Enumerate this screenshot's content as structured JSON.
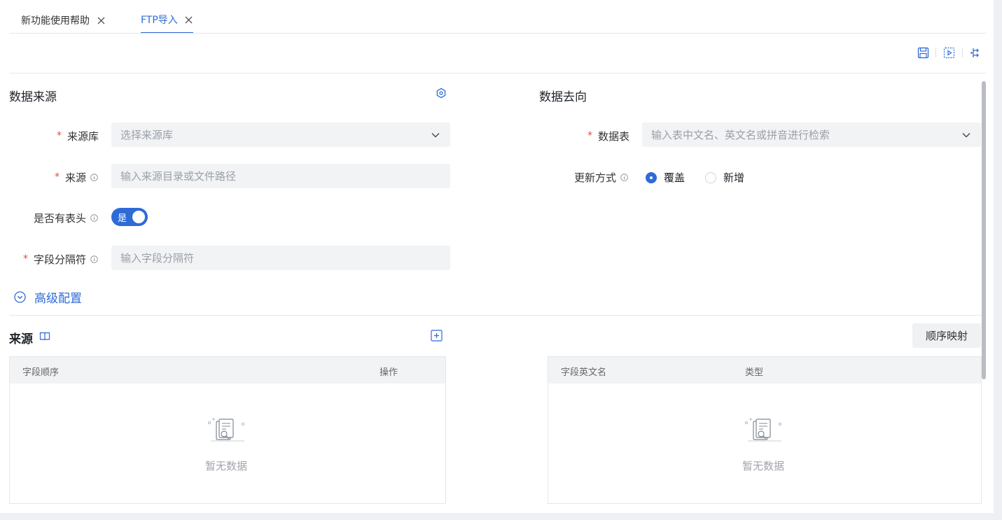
{
  "tabs": [
    {
      "label": "新功能使用帮助",
      "active": false
    },
    {
      "label": "FTP导入",
      "active": true
    }
  ],
  "toolbar": {
    "icons": [
      "save-icon",
      "run-icon",
      "split-icon"
    ]
  },
  "source_panel": {
    "title": "数据来源",
    "settings_icon": "settings-icon",
    "fields": {
      "source_db": {
        "label": "来源库",
        "required": true,
        "placeholder": "选择来源库"
      },
      "source_path": {
        "label": "来源",
        "required": true,
        "placeholder": "输入来源目录或文件路径"
      },
      "has_header": {
        "label": "是否有表头",
        "value": "是",
        "on": true
      },
      "delimiter": {
        "label": "字段分隔符",
        "required": true,
        "placeholder": "输入字段分隔符"
      }
    },
    "advanced_label": "高级配置"
  },
  "target_panel": {
    "title": "数据去向",
    "fields": {
      "table": {
        "label": "数据表",
        "required": true,
        "placeholder": "输入表中文名、英文名或拼音进行检索"
      },
      "update_mode": {
        "label": "更新方式",
        "options": [
          "覆盖",
          "新增"
        ],
        "selected": "覆盖"
      }
    }
  },
  "mapping": {
    "source_title": "来源",
    "order_map_button": "顺序映射",
    "left_table": {
      "columns": [
        "字段顺序",
        "操作"
      ],
      "empty_text": "暂无数据"
    },
    "right_table": {
      "columns": [
        "字段英文名",
        "类型"
      ],
      "empty_text": "暂无数据"
    }
  },
  "colors": {
    "accent": "#2f6bd6",
    "required": "#e34d3b"
  }
}
